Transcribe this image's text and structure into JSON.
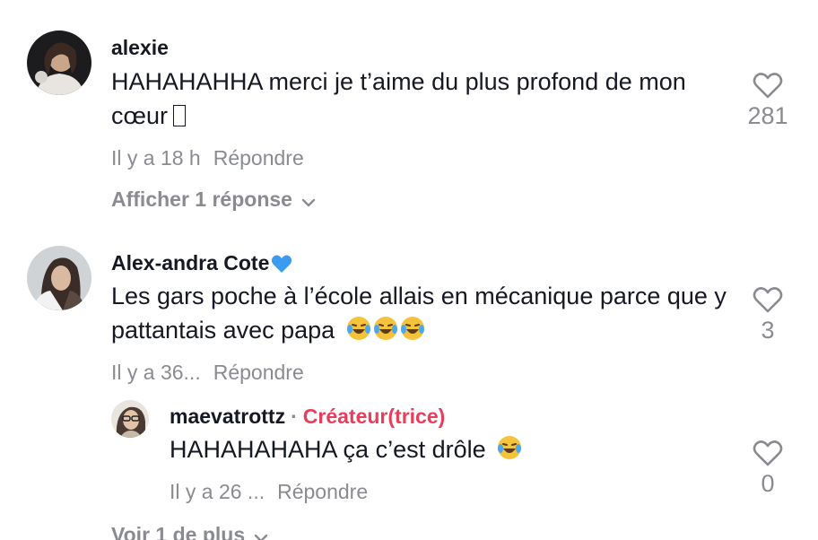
{
  "comments": [
    {
      "username": "alexie",
      "text": "HAHAHAHHA merci je t’aime du plus profond de mon cœur",
      "time": "Il y a 18 h",
      "reply_label": "Répondre",
      "likes": "281",
      "replies_toggle": "Afficher 1 réponse"
    },
    {
      "username": "Alex-andra Cote",
      "username_emoji": "blue-heart-icon",
      "text": "Les gars poche à l’école allais en mécanique parce que y pattantais avec papa",
      "time": "Il y a 36...",
      "reply_label": "Répondre",
      "likes": "3",
      "reply": {
        "username": "maevatrottz",
        "separator": "·",
        "creator_label": "Créateur(trice)",
        "text": "HAHAHAHAHA ça c’est drôle",
        "time": "Il y a 26 ...",
        "reply_label": "Répondre",
        "likes": "0"
      },
      "more_toggle": "Voir 1 de plus"
    }
  ],
  "colors": {
    "text": "#161823",
    "muted": "#8a8b91",
    "creator": "#e83e5c",
    "heart_emoji": "#3a9bf0",
    "laugh_emoji": "#f5c33b"
  }
}
